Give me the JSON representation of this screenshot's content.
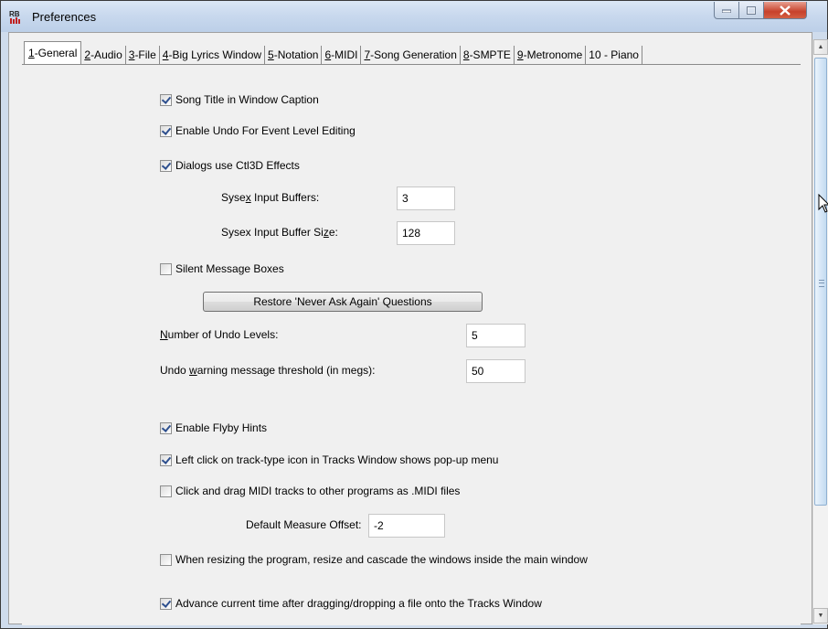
{
  "window": {
    "title": "Preferences",
    "app_icon": "rb-app-icon"
  },
  "window_controls": {
    "minimize": "minimize-icon",
    "maximize": "maximize-icon",
    "close": "close-icon"
  },
  "tabs": [
    {
      "pre": "",
      "key": "1",
      "post": "-General",
      "active": true
    },
    {
      "pre": "",
      "key": "2",
      "post": "-Audio",
      "active": false
    },
    {
      "pre": "",
      "key": "3",
      "post": "-File",
      "active": false
    },
    {
      "pre": "",
      "key": "4",
      "post": "-Big Lyrics Window",
      "active": false
    },
    {
      "pre": "",
      "key": "5",
      "post": "-Notation",
      "active": false
    },
    {
      "pre": "",
      "key": "6",
      "post": "-MIDI",
      "active": false
    },
    {
      "pre": "",
      "key": "7",
      "post": "-Song Generation",
      "active": false
    },
    {
      "pre": "",
      "key": "8",
      "post": "-SMPTE",
      "active": false
    },
    {
      "pre": "",
      "key": "9",
      "post": "-Metronome",
      "active": false
    },
    {
      "pre": "10 - Piano",
      "key": "",
      "post": "",
      "active": false
    }
  ],
  "general": {
    "song_title_caption": {
      "label": "Song Title in Window Caption",
      "checked": true
    },
    "enable_undo": {
      "label": "Enable Undo For Event Level Editing",
      "checked": true
    },
    "ctl3d": {
      "label": "Dialogs use Ctl3D Effects",
      "checked": true
    },
    "sysex_buffers": {
      "pre": "Syse",
      "key": "x",
      "post": " Input Buffers:",
      "value": "3"
    },
    "sysex_buffer_size": {
      "pre": "Sysex Input Buffer Si",
      "key": "z",
      "post": "e:",
      "value": "128"
    },
    "silent_messages": {
      "label": "Silent Message Boxes",
      "checked": false
    },
    "restore_button": "Restore 'Never Ask Again' Questions",
    "undo_levels": {
      "pre": "",
      "key": "N",
      "post": "umber of Undo Levels:",
      "value": "5"
    },
    "undo_threshold": {
      "pre": "Undo ",
      "key": "w",
      "post": "arning message threshold (in megs):",
      "value": "50"
    },
    "flyby_hints": {
      "label": "Enable Flyby Hints",
      "checked": true
    },
    "left_click_popup": {
      "label": "Left click on track-type icon in Tracks Window shows pop-up menu",
      "checked": true
    },
    "drag_midi": {
      "label": "Click and drag MIDI tracks to other programs as .MIDI files",
      "checked": false
    },
    "default_measure_offset": {
      "label": "Default Measure Offset:",
      "value": "-2"
    },
    "resize_cascade": {
      "label": "When resizing the program, resize and cascade the windows inside the main window",
      "checked": false
    },
    "advance_time": {
      "label": "Advance current time after dragging/dropping a file onto the Tracks Window",
      "checked": true
    }
  },
  "scrollbar": {
    "up": "scroll-up-icon",
    "down": "scroll-down-icon",
    "grip": "scroll-grip-icon"
  }
}
